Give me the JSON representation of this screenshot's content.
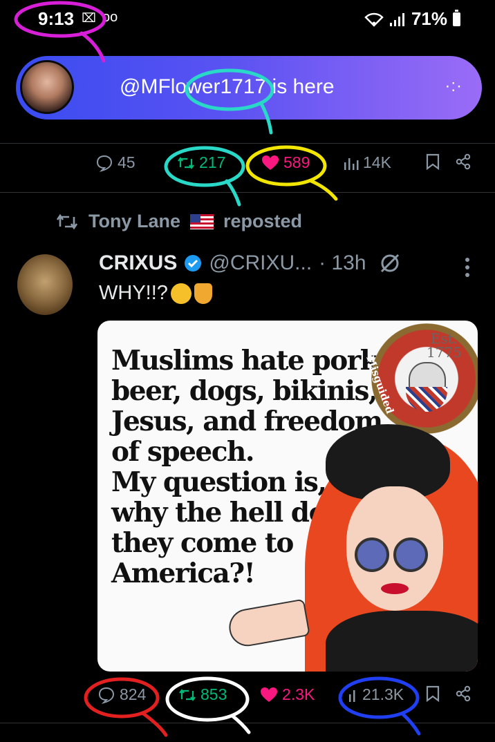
{
  "status_bar": {
    "time": "9:13",
    "indicator": "⌧",
    "voicemail": "oo",
    "battery": "71%"
  },
  "banner": {
    "text": "@MFlower1717 is here",
    "more": "·:·"
  },
  "top_post_actions": {
    "replies": "45",
    "reposts": "217",
    "likes": "589",
    "views": "14K"
  },
  "repost_context": {
    "reposter": "Tony Lane",
    "label": "reposted"
  },
  "tweet": {
    "name": "CRIXUS",
    "handle": "@CRIXU...",
    "time": "· 13h",
    "text": "WHY!!?",
    "meme": {
      "lines": [
        "Muslims hate pork,",
        "beer, dogs, bikinis,",
        "Jesus, and freedom",
        "of speech.",
        "My question is,",
        "why the hell do",
        "they come to",
        "America?!"
      ],
      "seal_est": "Est.",
      "seal_year": "1775",
      "seal_ring": "Misguided"
    },
    "actions": {
      "replies": "824",
      "reposts": "853",
      "likes": "2.3K",
      "views": "21.3K"
    }
  },
  "colors": {
    "accent_green": "#00ba7c",
    "accent_pink": "#f91880",
    "muted": "#8b98a5",
    "annotation_magenta": "#d81fd8",
    "annotation_cyan": "#2ad8c8",
    "annotation_yellow": "#f2e600",
    "annotation_red": "#e32020",
    "annotation_white": "#ffffff",
    "annotation_blue": "#1f3ff0"
  }
}
